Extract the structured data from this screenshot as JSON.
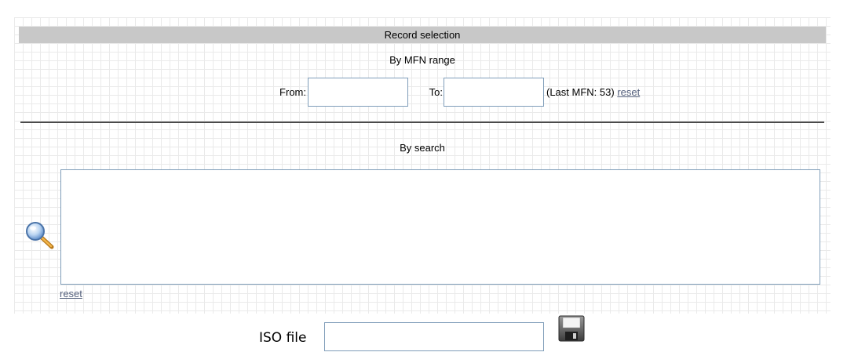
{
  "header": {
    "title": "Record selection"
  },
  "mfn_range": {
    "title": "By MFN range",
    "from_label": "From:",
    "from_value": "",
    "to_label": "To:",
    "to_value": "",
    "last_mfn_text": "(Last MFN: 53)",
    "reset_label": "reset"
  },
  "search": {
    "title": "By search",
    "query_value": "",
    "icon": "search-magnifier-icon",
    "reset_label": "reset"
  },
  "iso": {
    "label": "ISO file",
    "value": "",
    "save_icon": "floppy-disk-icon"
  },
  "colors": {
    "header_bg": "#c8c8c8",
    "grid_line": "#eaeaea",
    "input_border": "#7f9db9",
    "link": "#55617d",
    "divider": "#4a4a4a"
  }
}
